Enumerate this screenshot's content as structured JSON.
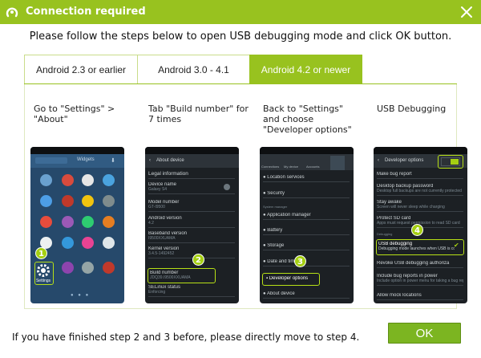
{
  "window": {
    "title": "Connection required",
    "accent": "#98c21f",
    "logo_icon": "app-logo-icon",
    "close_icon": "close-icon"
  },
  "instruction": "Please follow the steps below to open USB debugging mode and click OK button.",
  "tabs": [
    {
      "label": "Android 2.3 or earlier",
      "active": false
    },
    {
      "label": "Android 3.0 - 4.1",
      "active": false
    },
    {
      "label": "Android 4.2 or newer",
      "active": true
    }
  ],
  "steps": [
    {
      "number": "1",
      "text": "Go to \"Settings\" >\n\"About\""
    },
    {
      "number": "2",
      "text": "Tab \"Build number\" for\n7 times"
    },
    {
      "number": "3",
      "text": "Back to \"Settings\"\nand choose\n\"Developer options\""
    },
    {
      "number": "4",
      "text": "USB Debugging"
    }
  ],
  "screens": {
    "s1": {
      "tab_widgets": "Widgets",
      "settings_label": "Settings"
    },
    "s2": {
      "header": "About device",
      "legal": "Legal information",
      "rows": [
        {
          "label": "Device name",
          "value": "Galaxy S4"
        },
        {
          "label": "Model number",
          "value": "GT-I9500"
        },
        {
          "label": "Android version",
          "value": "4.2"
        },
        {
          "label": "Baseband version",
          "value": "I9500XXUAMA"
        },
        {
          "label": "Kernel version",
          "value": "3.4.5-1492452"
        }
      ],
      "build": {
        "label": "Build number",
        "value": "JDQ39.I9500XXUAMA"
      },
      "selinux": {
        "label": "SELinux status",
        "value": "Enforcing"
      }
    },
    "s3": {
      "tabs": [
        "Connections",
        "My device",
        "Accounts",
        "More"
      ],
      "rows": [
        "Location services",
        "Security",
        "Application manager",
        "Battery",
        "Storage",
        "Date and time"
      ],
      "section": "System manager",
      "dev": "Developer options",
      "about": "About device"
    },
    "s4": {
      "header": "Developer options",
      "rows": [
        {
          "label": "Make bug report",
          "value": ""
        },
        {
          "label": "Desktop backup password",
          "value": "Desktop full backups are not currently protected"
        },
        {
          "label": "Stay awake",
          "value": "Screen will never sleep while charging"
        },
        {
          "label": "Protect SD card",
          "value": "Apps must request permission to read SD card"
        }
      ],
      "section": "Debugging",
      "usb": {
        "label": "USB debugging",
        "value": "Debugging mode launches when USB is connected"
      },
      "after": [
        {
          "label": "Revoke USB debugging authoriza",
          "value": ""
        },
        {
          "label": "Include bug reports in power",
          "value": "Include option in power menu for taking a bug report"
        },
        {
          "label": "Allow mock locations",
          "value": ""
        }
      ]
    }
  },
  "footer_text": "If you have finished step 2 and 3 before, please directly move to step 4.",
  "ok_label": "OK"
}
